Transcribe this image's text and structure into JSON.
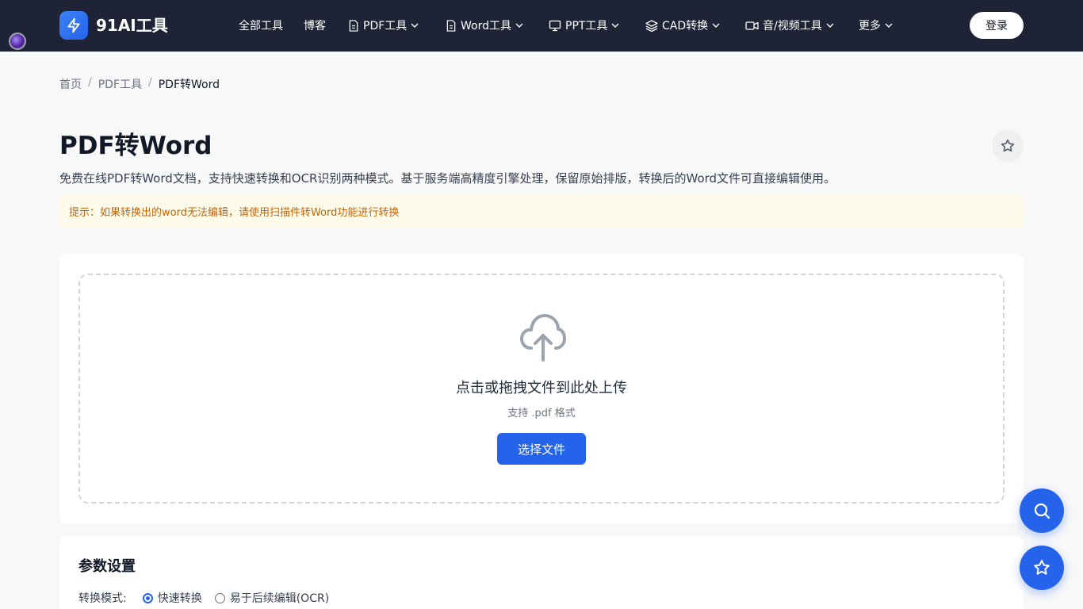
{
  "brand": {
    "name": "91AI工具"
  },
  "nav": {
    "items": [
      {
        "label": "全部工具",
        "icon": ""
      },
      {
        "label": "博客",
        "icon": ""
      },
      {
        "label": "PDF工具",
        "icon": "file-icon",
        "dropdown": true
      },
      {
        "label": "Word工具",
        "icon": "file-icon",
        "dropdown": true
      },
      {
        "label": "PPT工具",
        "icon": "presentation-icon",
        "dropdown": true
      },
      {
        "label": "CAD转换",
        "icon": "layers-icon",
        "dropdown": true
      },
      {
        "label": "音/视频工具",
        "icon": "video-icon",
        "dropdown": true
      },
      {
        "label": "更多",
        "icon": "",
        "dropdown": true
      }
    ],
    "login_label": "登录"
  },
  "breadcrumb": {
    "home": "首页",
    "section": "PDF工具",
    "current": "PDF转Word",
    "separator": "/"
  },
  "page": {
    "title": "PDF转Word",
    "description": "免费在线PDF转Word文档，支持快速转换和OCR识别两种模式。基于服务端高精度引擎处理，保留原始排版，转换后的Word文件可直接编辑使用。",
    "tip": "提示：如果转换出的word无法编辑，请使用扫描件转Word功能进行转换"
  },
  "upload": {
    "title": "点击或拖拽文件到此处上传",
    "hint": "支持 .pdf 格式",
    "button_label": "选择文件"
  },
  "params": {
    "title": "参数设置",
    "mode_label": "转换模式:",
    "options": [
      {
        "label": "快速转换",
        "selected": true
      },
      {
        "label": "易于后续编辑(OCR)",
        "selected": false
      }
    ]
  },
  "colors": {
    "nav_bg": "#1e2435",
    "accent": "#2563eb",
    "tip_bg": "#fefbea",
    "tip_text": "#c2640a"
  }
}
